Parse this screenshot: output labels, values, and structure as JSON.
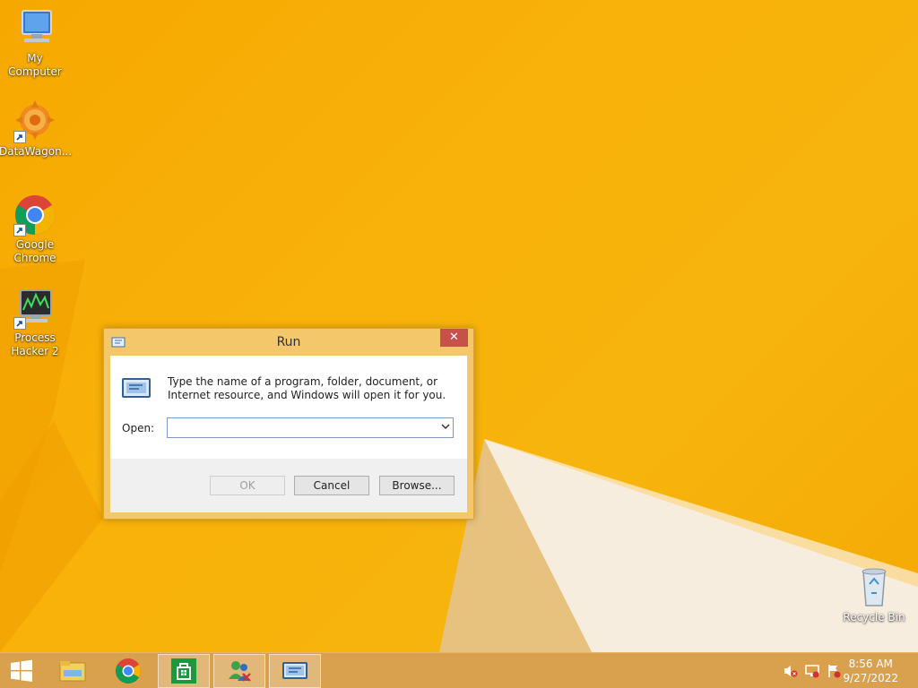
{
  "desktop": {
    "icons": [
      {
        "label": "My Computer"
      },
      {
        "label": "DataWagon..."
      },
      {
        "label": "Google Chrome"
      },
      {
        "label": "Process Hacker 2"
      },
      {
        "label": "Recycle Bin"
      }
    ]
  },
  "run_dialog": {
    "title": "Run",
    "close_label": "✕",
    "description": "Type the name of a program, folder, document, or Internet resource, and Windows will open it for you.",
    "open_label": "Open:",
    "open_value": "",
    "ok_label": "OK",
    "cancel_label": "Cancel",
    "browse_label": "Browse..."
  },
  "taskbar": {
    "items": [
      "Start",
      "File Explorer",
      "Google Chrome",
      "Store",
      "Network",
      "Run"
    ],
    "active": "Run",
    "clock_time": "8:56 AM",
    "clock_date": "9/27/2022"
  },
  "colors": {
    "desktop": "#f7b20a",
    "taskbar": "#d9a14e",
    "dialog_frame": "#f4c76a",
    "close_button": "#c7504b"
  }
}
